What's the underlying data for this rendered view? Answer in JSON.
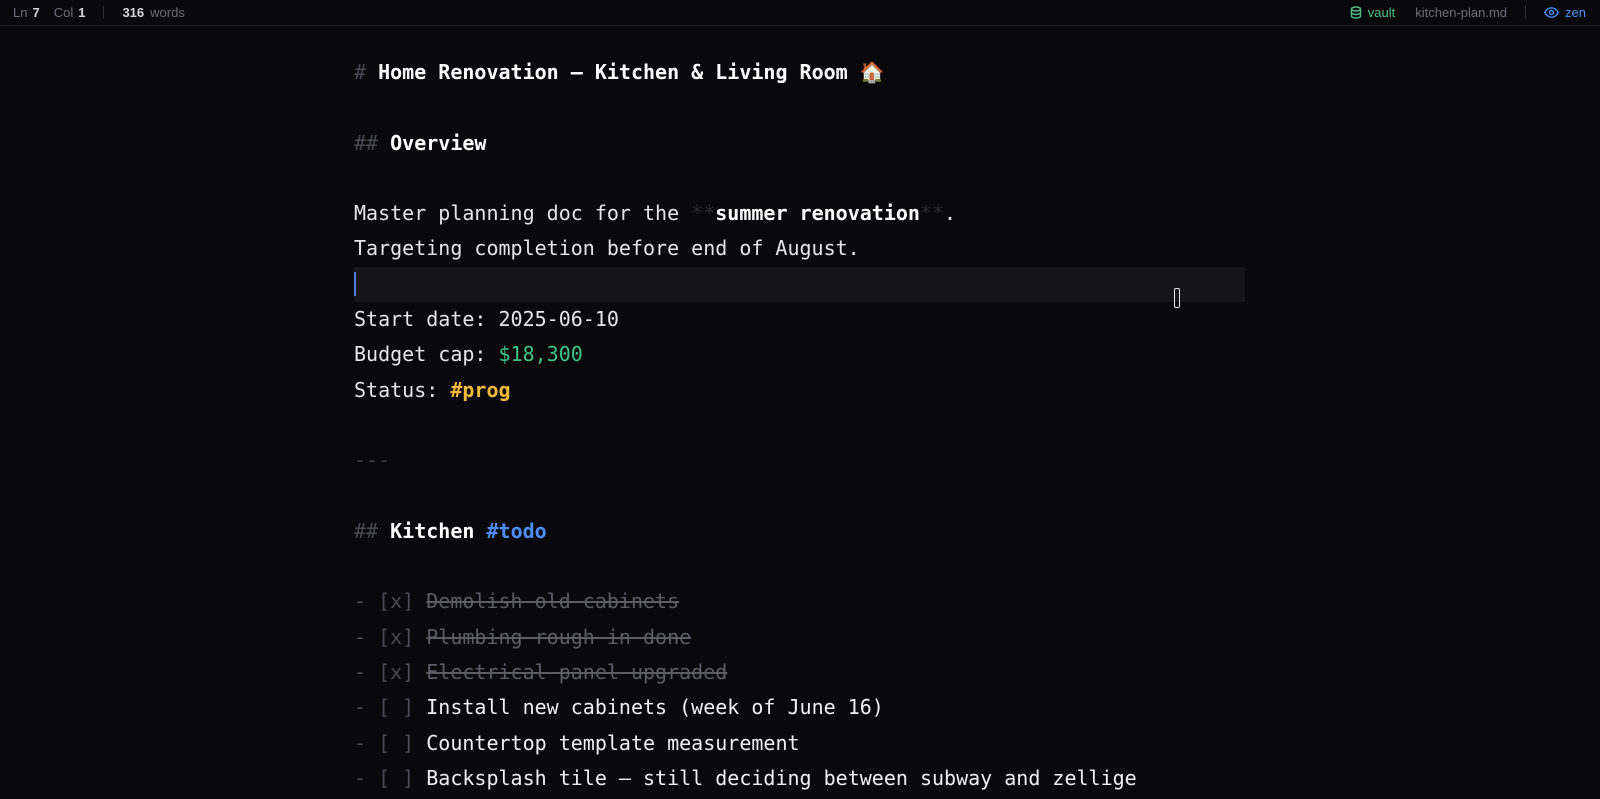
{
  "statusbar": {
    "ln_label": "Ln",
    "ln_value": "7",
    "col_label": "Col",
    "col_value": "1",
    "word_count": "316",
    "words_label": "words",
    "vault_label": "vault",
    "filename": "kitchen-plan.md",
    "zen_label": "zen",
    "vault_icon": "database-icon",
    "zen_icon": "eye-icon"
  },
  "colors": {
    "background": "#09090b",
    "accent_blue": "#4c8df6",
    "vault_green": "#4fbf87",
    "money_green": "#3ec487",
    "tag_yellow": "#f0b93a"
  },
  "document": {
    "h1_marker": "#",
    "h1_text": "Home Renovation — Kitchen & Living Room",
    "h1_emoji": "🏠",
    "overview_marker": "##",
    "overview_text": "Overview",
    "intro_prefix": "Master planning doc for the ",
    "bold_open": "**",
    "intro_bold": "summer renovation",
    "bold_close": "**",
    "intro_suffix": ".",
    "intro_line2": "Targeting completion before end of August.",
    "start_label": "Start date: ",
    "start_value": "2025-06-10",
    "budget_label": "Budget cap: ",
    "budget_value": "$18,300",
    "status_label": "Status: ",
    "status_tag": "#prog",
    "hr": "---",
    "kitchen_marker": "##",
    "kitchen_text": "Kitchen",
    "kitchen_tag": "#todo",
    "tasks": [
      {
        "bullet": "-",
        "box": "[x]",
        "text": "Demolish old cabinets",
        "done": true
      },
      {
        "bullet": "-",
        "box": "[x]",
        "text": "Plumbing rough-in done",
        "done": true
      },
      {
        "bullet": "-",
        "box": "[x]",
        "text": "Electrical panel upgraded",
        "done": true
      },
      {
        "bullet": "-",
        "box": "[ ]",
        "text": "Install new cabinets (week of June 16)",
        "done": false
      },
      {
        "bullet": "-",
        "box": "[ ]",
        "text": "Countertop template measurement",
        "done": false
      },
      {
        "bullet": "-",
        "box": "[ ]",
        "text": "Backsplash tile — still deciding between subway and zellige",
        "done": false
      }
    ]
  }
}
